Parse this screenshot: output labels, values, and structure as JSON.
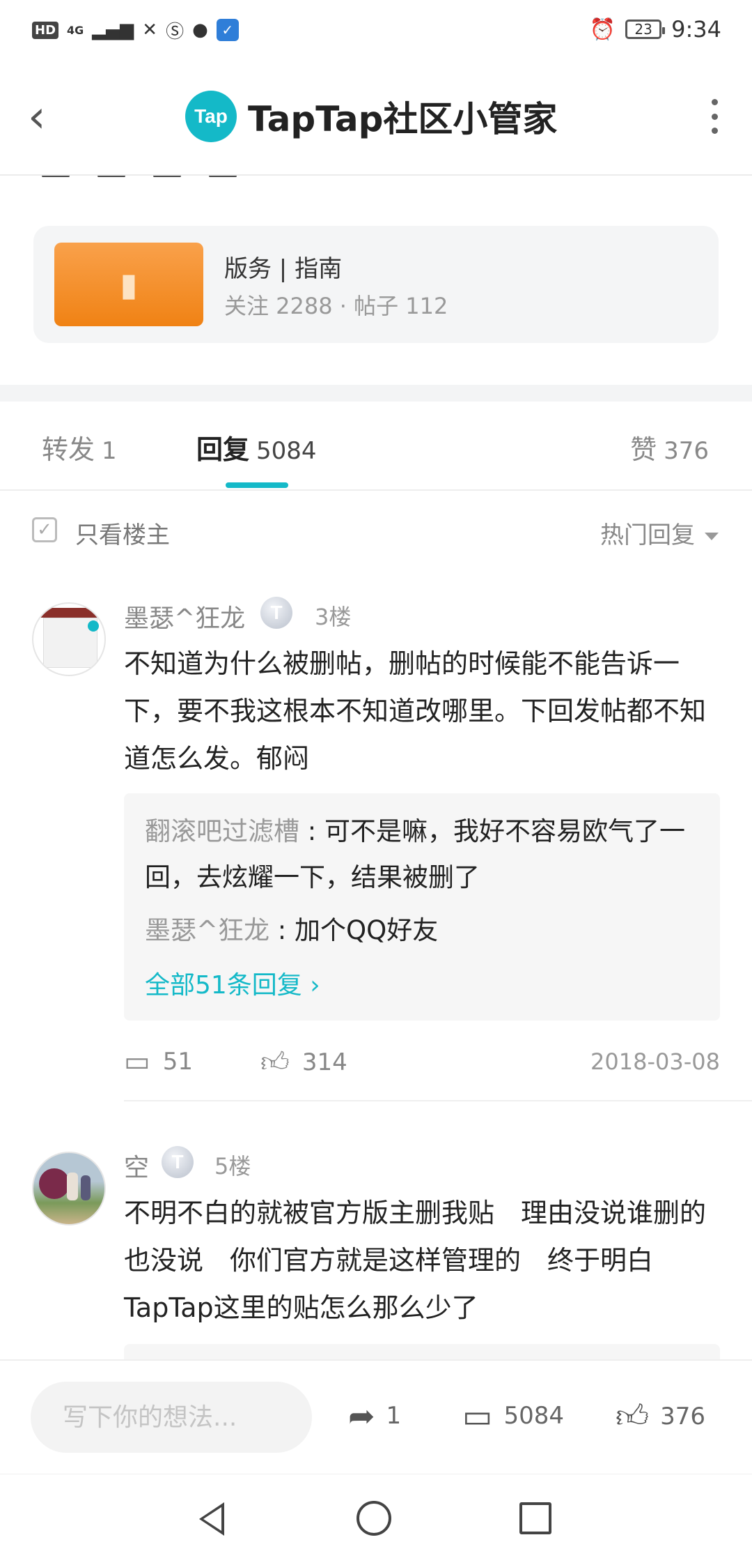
{
  "status_bar": {
    "network_label": "HD",
    "signal_label": "4G",
    "battery": "23",
    "time": "9:34"
  },
  "header": {
    "logo_text": "Tap",
    "title": "TapTap社区小管家"
  },
  "group": {
    "name": "版务 | 指南",
    "stats": "关注 2288 · 帖子 112"
  },
  "tabs": [
    {
      "label": "转发",
      "count": "1"
    },
    {
      "label": "回复",
      "count": "5084"
    },
    {
      "label": "赞",
      "count": "376"
    }
  ],
  "filter": {
    "only_op_label": "只看楼主",
    "sort_label": "热门回复"
  },
  "comments": [
    {
      "username": "墨瑟^狂龙",
      "badge": "T",
      "floor": "3楼",
      "text": "不知道为什么被删帖，删帖的时候能不能告诉一下，要不我这根本不知道改哪里。下回发帖都不知道怎么发。郁闷",
      "replies": [
        {
          "name": "翻滚吧过滤槽",
          "text": "可不是嘛，我好不容易欧气了一回，去炫耀一下，结果被删了"
        },
        {
          "name": "墨瑟^狂龙",
          "text": "加个QQ好友"
        }
      ],
      "more_replies": "全部51条回复",
      "reply_count": "51",
      "like_count": "314",
      "date": "2018-03-08"
    },
    {
      "username": "空",
      "badge": "T",
      "floor": "5楼",
      "text": "不明不白的就被官方版主删我贴　理由没说谁删的也没说　你们官方就是这样管理的　终于明白TapTap这里的贴怎么那么少了"
    }
  ],
  "bottom_bar": {
    "input_placeholder": "写下你的想法...",
    "share_count": "1",
    "comment_count": "5084",
    "like_count": "376"
  },
  "icons": {
    "back": "back-arrow-icon",
    "more": "more-vertical-icon",
    "book": "book-icon",
    "comment": "comment-icon",
    "like": "thumbs-up-icon",
    "share": "share-icon"
  },
  "colors": {
    "accent": "#14b9c8",
    "group_thumb": "#f08214"
  }
}
